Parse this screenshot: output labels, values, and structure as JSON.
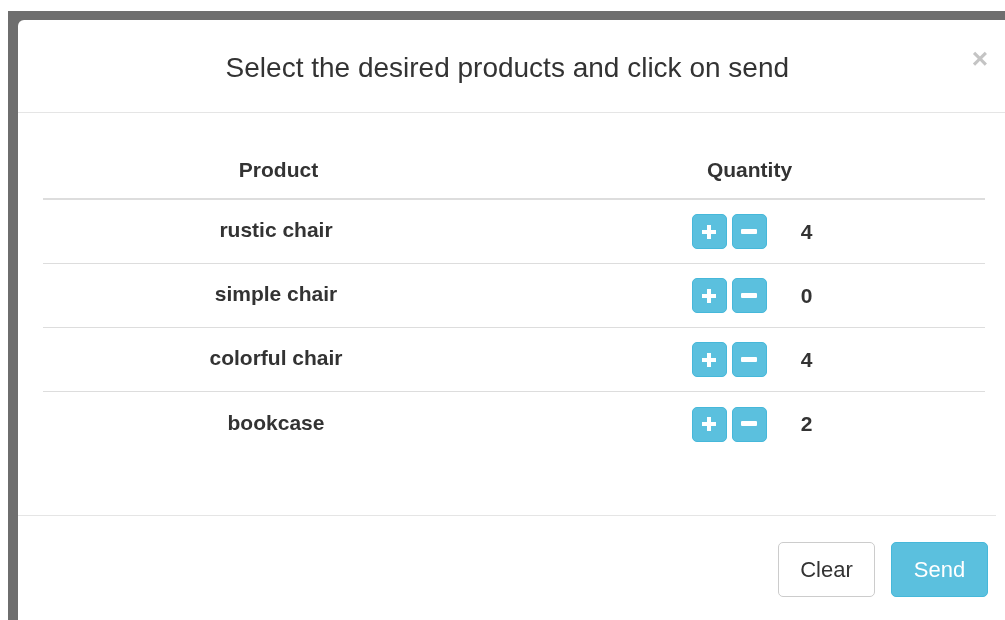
{
  "dialog": {
    "title": "Select the desired products and click on send",
    "close": "×"
  },
  "table": {
    "columns": [
      "Product",
      "Quantity"
    ],
    "rows": [
      {
        "product": "rustic chair",
        "quantity": "4"
      },
      {
        "product": "simple chair",
        "quantity": "0"
      },
      {
        "product": "colorful chair",
        "quantity": "4"
      },
      {
        "product": "bookcase",
        "quantity": "2"
      }
    ]
  },
  "buttons": [
    {
      "label": "Clear",
      "kind": "default"
    },
    {
      "label": "Send",
      "kind": "primary"
    }
  ]
}
